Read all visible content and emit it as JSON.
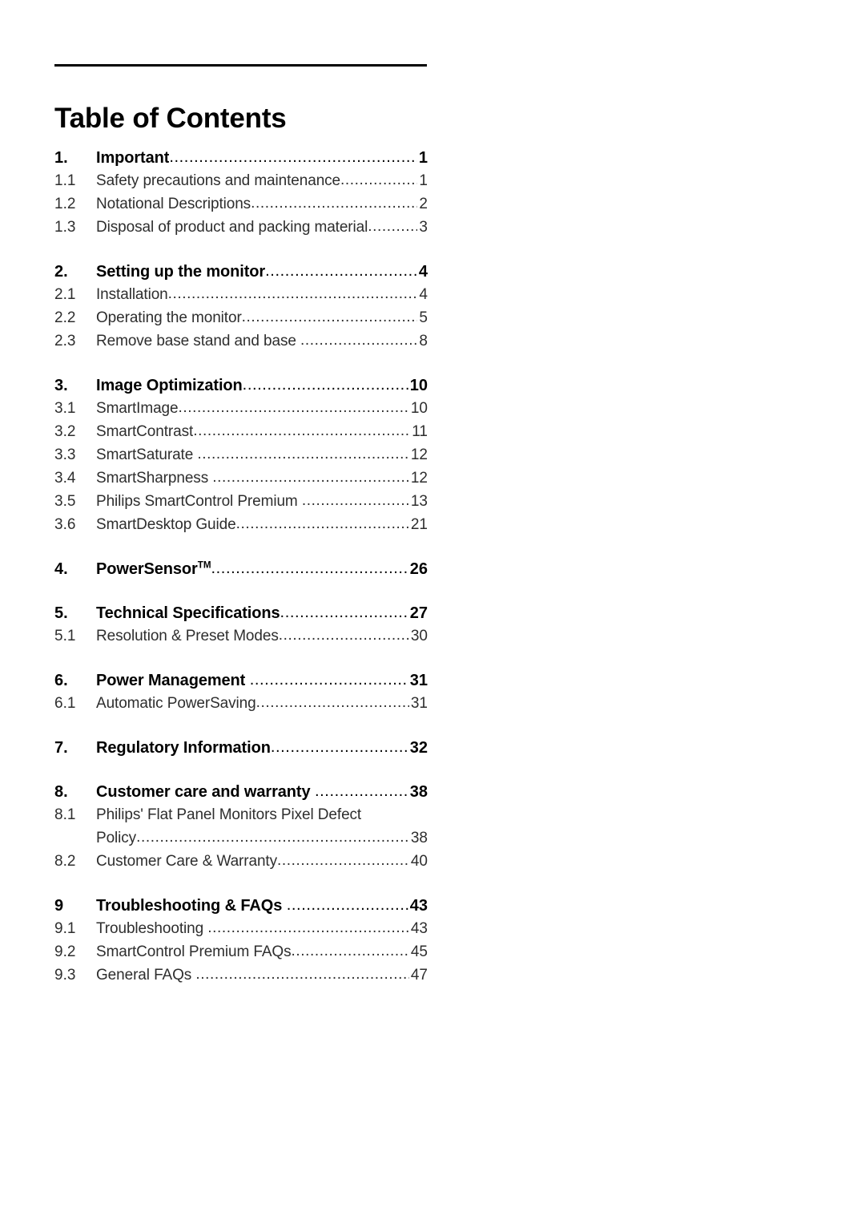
{
  "document": {
    "title": "Table of Contents",
    "page_background": "#ffffff",
    "text_color_primary": "#000000",
    "text_color_secondary": "#2e2e2e",
    "rule_color": "#000000"
  },
  "toc": {
    "groups": [
      {
        "entries": [
          {
            "level": 1,
            "number": "1.",
            "title": "Important",
            "page": "1"
          },
          {
            "level": 2,
            "number": "1.1",
            "title": "Safety precautions and maintenance",
            "page": "1"
          },
          {
            "level": 2,
            "number": "1.2",
            "title": "Notational Descriptions",
            "page": "2"
          },
          {
            "level": 2,
            "number": "1.3",
            "title": "Disposal of product and packing material",
            "page": "3"
          }
        ]
      },
      {
        "entries": [
          {
            "level": 1,
            "number": "2.",
            "title": "Setting up the monitor",
            "page": "4"
          },
          {
            "level": 2,
            "number": "2.1",
            "title": "Installation",
            "page": "4"
          },
          {
            "level": 2,
            "number": "2.2",
            "title": "Operating the monitor",
            "page": "5"
          },
          {
            "level": 2,
            "number": "2.3",
            "title": "Remove base stand and base",
            "page": "8",
            "gap": true
          }
        ]
      },
      {
        "entries": [
          {
            "level": 1,
            "number": "3.",
            "title": "Image Optimization",
            "page": "10"
          },
          {
            "level": 2,
            "number": "3.1",
            "title": "SmartImage",
            "page": "10"
          },
          {
            "level": 2,
            "number": "3.2",
            "title": "SmartContrast",
            "page": "11"
          },
          {
            "level": 2,
            "number": "3.3",
            "title": "SmartSaturate",
            "page": "12",
            "gap": true
          },
          {
            "level": 2,
            "number": "3.4",
            "title": "SmartSharpness",
            "page": "12",
            "gap": true
          },
          {
            "level": 2,
            "number": "3.5",
            "title": "Philips SmartControl Premium",
            "page": "13",
            "gap": true
          },
          {
            "level": 2,
            "number": "3.6",
            "title": "SmartDesktop Guide",
            "page": "21"
          }
        ]
      },
      {
        "entries": [
          {
            "level": 1,
            "number": "4.",
            "title": "PowerSensor",
            "superscript": "TM",
            "page": "26"
          }
        ]
      },
      {
        "entries": [
          {
            "level": 1,
            "number": "5.",
            "title": "Technical Specifications",
            "page": "27"
          },
          {
            "level": 2,
            "number": "5.1",
            "title": "Resolution & Preset Modes",
            "page": "30"
          }
        ]
      },
      {
        "entries": [
          {
            "level": 1,
            "number": "6.",
            "title": "Power Management",
            "page": "31",
            "gap": true
          },
          {
            "level": 2,
            "number": "6.1",
            "title": "Automatic PowerSaving",
            "page": "31"
          }
        ]
      },
      {
        "entries": [
          {
            "level": 1,
            "number": "7.",
            "title": "Regulatory Information",
            "page": "32"
          }
        ]
      },
      {
        "entries": [
          {
            "level": 1,
            "number": "8.",
            "title": "Customer care and warranty",
            "page": "38",
            "gap": true
          },
          {
            "level": 2,
            "number": "8.1",
            "title": "Philips' Flat Panel Monitors Pixel Defect",
            "wrap_continuation": "Policy",
            "page": "38"
          },
          {
            "level": 2,
            "number": "8.2",
            "title": "Customer Care & Warranty",
            "page": "40"
          }
        ]
      },
      {
        "entries": [
          {
            "level": 1,
            "number": "9",
            "title": "Troubleshooting & FAQs",
            "page": "43",
            "gap": true
          },
          {
            "level": 2,
            "number": "9.1",
            "title": "Troubleshooting",
            "page": "43",
            "gap": true
          },
          {
            "level": 2,
            "number": "9.2",
            "title": "SmartControl Premium FAQs",
            "page": "45"
          },
          {
            "level": 2,
            "number": "9.3",
            "title": "General FAQs",
            "page": "47",
            "gap": true
          }
        ]
      }
    ]
  }
}
